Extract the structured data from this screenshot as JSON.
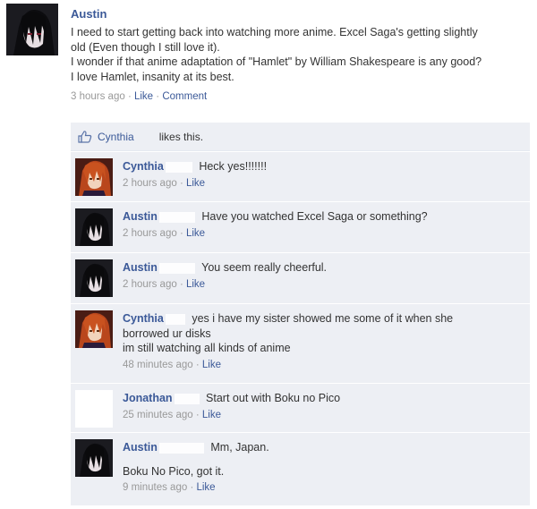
{
  "post": {
    "author": "Austin",
    "lines": [
      "I need to start getting back into watching more anime. Excel Saga's getting slightly",
      "old (Even though I still love it).",
      "I wonder if that anime adaptation of \"Hamlet\" by William Shakespeare is any good?",
      "I love Hamlet, insanity at its best."
    ],
    "time": "3 hours ago",
    "like_label": "Like",
    "comment_label": "Comment",
    "sep": " · "
  },
  "likes": {
    "name": "Cynthia",
    "text": "likes this."
  },
  "comments": [
    {
      "author": "Cynthia",
      "lines": [
        "Heck yes!!!!!!!"
      ],
      "time": "2 hours ago",
      "like_label": "Like"
    },
    {
      "author": "Austin",
      "lines": [
        "Have you watched Excel Saga or something?"
      ],
      "time": "2 hours ago",
      "like_label": "Like"
    },
    {
      "author": "Austin",
      "lines": [
        "You seem really cheerful."
      ],
      "time": "2 hours ago",
      "like_label": "Like"
    },
    {
      "author": "Cynthia",
      "lines": [
        "yes i have my sister showed me some of it when she",
        "borrowed ur disks",
        "im still watching all kinds of anime"
      ],
      "time": "48 minutes ago",
      "like_label": "Like"
    },
    {
      "author": "Jonathan",
      "lines": [
        "Start out with Boku no Pico"
      ],
      "time": "25 minutes ago",
      "like_label": "Like"
    },
    {
      "author": "Austin",
      "lines": [
        "Mm, Japan.",
        "",
        "Boku No Pico, got it."
      ],
      "time": "9 minutes ago",
      "like_label": "Like"
    }
  ],
  "colors": {
    "link": "#3b5998",
    "feedback_bg": "#edeff4",
    "meta": "#999999"
  }
}
